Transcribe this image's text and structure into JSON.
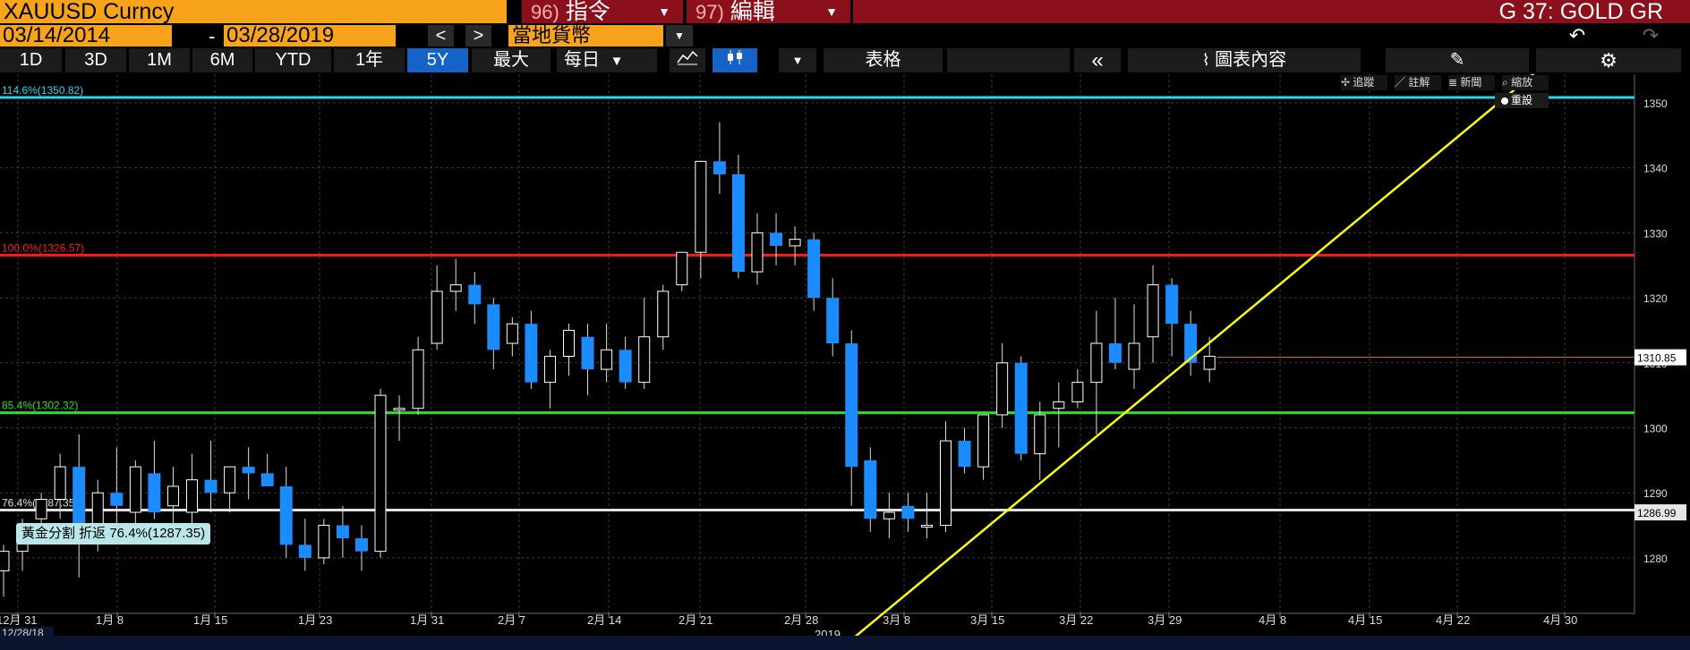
{
  "topbar": {
    "security": "XAUUSD Curncy",
    "menu_actions": {
      "num": "96)",
      "label": "指令"
    },
    "menu_edit": {
      "num": "97)",
      "label": "編輯"
    },
    "title": "G 37: GOLD GR"
  },
  "daterange": {
    "start": "03/14/2014",
    "end": "03/28/2019",
    "currency": "當地貨幣"
  },
  "periods": [
    "1D",
    "3D",
    "1M",
    "6M",
    "YTD",
    "1年",
    "5Y",
    "最大"
  ],
  "active_period": "5Y",
  "toolbar": {
    "frequency": "每日",
    "table_label": "表格",
    "chart_content_label": "圖表內容"
  },
  "annotations": {
    "track": "追蹤",
    "annotate": "註解",
    "news": "新聞",
    "zoom": "縮放",
    "reset": "重設"
  },
  "fib_box_label": "黃金分割 折返 76.4%(1287.35)",
  "footer_date": "12/28/18",
  "year_label": "2019",
  "colors": {
    "up_candle": "#ffffff",
    "down_candle": "#1a8cff",
    "fib_114": "#29d6f0",
    "fib_100": "#ff1a1a",
    "fib_85": "#28e028",
    "fib_76": "#e0e0e0",
    "trend": "#ffff00",
    "last_price_line": "#d97f00"
  },
  "chart_data": {
    "type": "candlestick",
    "ylim": [
      1273,
      1358
    ],
    "yticks": [
      1280,
      1290,
      1300,
      1310,
      1320,
      1330,
      1340,
      1350
    ],
    "xtick_labels": [
      "12月 31",
      "1月 8",
      "1月 15",
      "1月 23",
      "1月 31",
      "2月 7",
      "2月 14",
      "2月 21",
      "2月 28",
      "3月 8",
      "3月 15",
      "3月 22",
      "3月 29",
      "4月 8",
      "4月 15",
      "4月 22",
      "4月 30"
    ],
    "last_price": 1310.85,
    "fib_price_label": 1286.99,
    "fib_levels": [
      {
        "label": "114.6%(1350.82)",
        "value": 1350.82,
        "color": "#29d6f0"
      },
      {
        "label": "100.0%(1326.57)",
        "value": 1326.57,
        "color": "#ff1a1a"
      },
      {
        "label": "85.4%(1302.32)",
        "value": 1302.32,
        "color": "#28e028"
      },
      {
        "label": "76.4%(1287.35)",
        "value": 1287.35,
        "color": "#e0e0e0"
      }
    ],
    "trendline": {
      "from": {
        "index": 44,
        "value": 1265
      },
      "to": {
        "index": 86,
        "value": 1366
      }
    },
    "candles": [
      {
        "o": 1278,
        "h": 1282,
        "l": 1274,
        "c": 1281
      },
      {
        "o": 1281,
        "h": 1286,
        "l": 1278,
        "c": 1285
      },
      {
        "o": 1286,
        "h": 1290,
        "l": 1283,
        "c": 1289
      },
      {
        "o": 1289,
        "h": 1296,
        "l": 1286,
        "c": 1294
      },
      {
        "o": 1294,
        "h": 1299,
        "l": 1277,
        "c": 1285
      },
      {
        "o": 1284,
        "h": 1292,
        "l": 1281,
        "c": 1290
      },
      {
        "o": 1290,
        "h": 1297,
        "l": 1283,
        "c": 1288
      },
      {
        "o": 1287,
        "h": 1295,
        "l": 1284,
        "c": 1294
      },
      {
        "o": 1293,
        "h": 1298,
        "l": 1286,
        "c": 1287
      },
      {
        "o": 1288,
        "h": 1294,
        "l": 1284,
        "c": 1291
      },
      {
        "o": 1287,
        "h": 1296,
        "l": 1284,
        "c": 1292
      },
      {
        "o": 1292,
        "h": 1298,
        "l": 1287,
        "c": 1290
      },
      {
        "o": 1290,
        "h": 1294,
        "l": 1287,
        "c": 1294
      },
      {
        "o": 1294,
        "h": 1297,
        "l": 1289,
        "c": 1293
      },
      {
        "o": 1293,
        "h": 1296,
        "l": 1291,
        "c": 1291
      },
      {
        "o": 1291,
        "h": 1294,
        "l": 1280,
        "c": 1282
      },
      {
        "o": 1282,
        "h": 1286,
        "l": 1278,
        "c": 1280
      },
      {
        "o": 1280,
        "h": 1286,
        "l": 1279,
        "c": 1285
      },
      {
        "o": 1285,
        "h": 1288,
        "l": 1280,
        "c": 1283
      },
      {
        "o": 1283,
        "h": 1285,
        "l": 1278,
        "c": 1281
      },
      {
        "o": 1281,
        "h": 1306,
        "l": 1280,
        "c": 1305
      },
      {
        "o": 1303,
        "h": 1305,
        "l": 1298,
        "c": 1303
      },
      {
        "o": 1303,
        "h": 1314,
        "l": 1302,
        "c": 1312
      },
      {
        "o": 1313,
        "h": 1325,
        "l": 1312,
        "c": 1321
      },
      {
        "o": 1321,
        "h": 1326,
        "l": 1318,
        "c": 1322
      },
      {
        "o": 1322,
        "h": 1324,
        "l": 1316,
        "c": 1319
      },
      {
        "o": 1319,
        "h": 1320,
        "l": 1309,
        "c": 1312
      },
      {
        "o": 1313,
        "h": 1317,
        "l": 1311,
        "c": 1316
      },
      {
        "o": 1316,
        "h": 1318,
        "l": 1306,
        "c": 1307
      },
      {
        "o": 1307,
        "h": 1312,
        "l": 1303,
        "c": 1311
      },
      {
        "o": 1311,
        "h": 1316,
        "l": 1308,
        "c": 1315
      },
      {
        "o": 1314,
        "h": 1316,
        "l": 1305,
        "c": 1309
      },
      {
        "o": 1309,
        "h": 1316,
        "l": 1307,
        "c": 1312
      },
      {
        "o": 1312,
        "h": 1314,
        "l": 1306,
        "c": 1307
      },
      {
        "o": 1307,
        "h": 1320,
        "l": 1306,
        "c": 1314
      },
      {
        "o": 1314,
        "h": 1322,
        "l": 1312,
        "c": 1321
      },
      {
        "o": 1322,
        "h": 1327,
        "l": 1321,
        "c": 1327
      },
      {
        "o": 1327,
        "h": 1341,
        "l": 1323,
        "c": 1341
      },
      {
        "o": 1341,
        "h": 1347,
        "l": 1336,
        "c": 1339
      },
      {
        "o": 1339,
        "h": 1342,
        "l": 1323,
        "c": 1324
      },
      {
        "o": 1324,
        "h": 1333,
        "l": 1322,
        "c": 1330
      },
      {
        "o": 1330,
        "h": 1333,
        "l": 1325,
        "c": 1328
      },
      {
        "o": 1328,
        "h": 1331,
        "l": 1325,
        "c": 1329
      },
      {
        "o": 1329,
        "h": 1330,
        "l": 1318,
        "c": 1320
      },
      {
        "o": 1320,
        "h": 1323,
        "l": 1311,
        "c": 1313
      },
      {
        "o": 1313,
        "h": 1315,
        "l": 1288,
        "c": 1294
      },
      {
        "o": 1295,
        "h": 1297,
        "l": 1284,
        "c": 1286
      },
      {
        "o": 1286,
        "h": 1290,
        "l": 1283,
        "c": 1287
      },
      {
        "o": 1288,
        "h": 1290,
        "l": 1284,
        "c": 1286
      },
      {
        "o": 1285,
        "h": 1290,
        "l": 1283,
        "c": 1285
      },
      {
        "o": 1285,
        "h": 1301,
        "l": 1284,
        "c": 1298
      },
      {
        "o": 1298,
        "h": 1300,
        "l": 1293,
        "c": 1294
      },
      {
        "o": 1294,
        "h": 1302,
        "l": 1292,
        "c": 1302
      },
      {
        "o": 1302,
        "h": 1313,
        "l": 1300,
        "c": 1310
      },
      {
        "o": 1310,
        "h": 1311,
        "l": 1295,
        "c": 1296
      },
      {
        "o": 1296,
        "h": 1304,
        "l": 1292,
        "c": 1302
      },
      {
        "o": 1303,
        "h": 1307,
        "l": 1297,
        "c": 1304
      },
      {
        "o": 1304,
        "h": 1309,
        "l": 1303,
        "c": 1307
      },
      {
        "o": 1307,
        "h": 1318,
        "l": 1299,
        "c": 1313
      },
      {
        "o": 1313,
        "h": 1320,
        "l": 1309,
        "c": 1310
      },
      {
        "o": 1309,
        "h": 1319,
        "l": 1306,
        "c": 1313
      },
      {
        "o": 1314,
        "h": 1325,
        "l": 1310,
        "c": 1322
      },
      {
        "o": 1322,
        "h": 1323,
        "l": 1311,
        "c": 1316
      },
      {
        "o": 1316,
        "h": 1318,
        "l": 1308,
        "c": 1310
      },
      {
        "o": 1309,
        "h": 1314,
        "l": 1307,
        "c": 1311
      }
    ]
  }
}
